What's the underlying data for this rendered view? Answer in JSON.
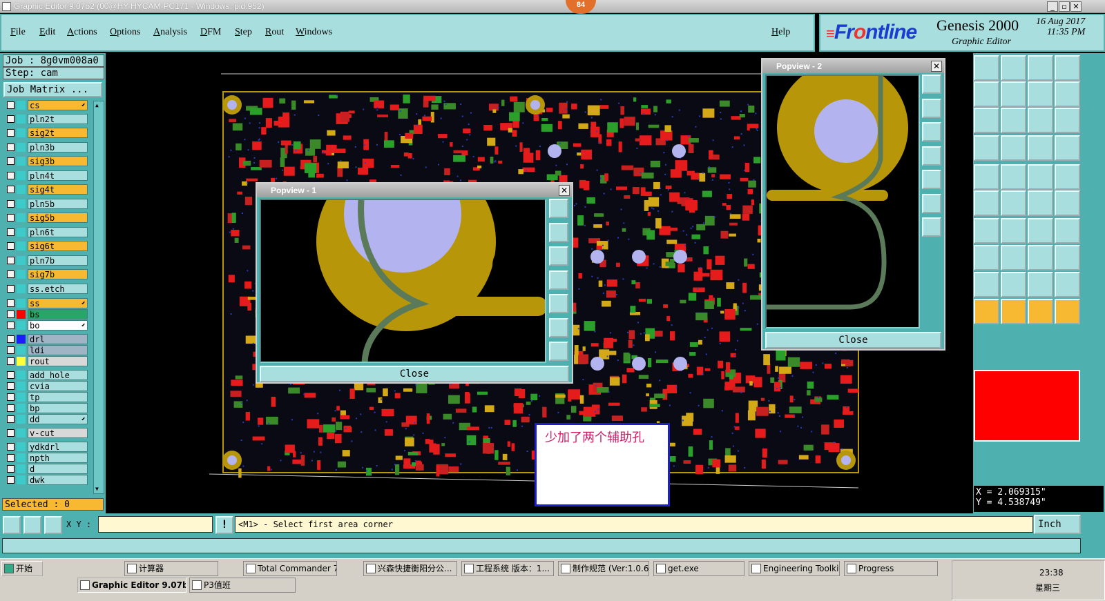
{
  "window": {
    "title": "Graphic Editor 9.07b2 (00@HY-HYCAM-PC171 - Windows, pid:952)",
    "badge": "84"
  },
  "menu": {
    "items": [
      "File",
      "Edit",
      "Actions",
      "Options",
      "Analysis",
      "DFM",
      "Step",
      "Rout",
      "Windows"
    ],
    "help": "Help"
  },
  "branding": {
    "logo_a": "Fr",
    "logo_b": "o",
    "logo_c": "ntline",
    "product": "Genesis 2000",
    "subtitle": "Graphic Editor",
    "date": "16 Aug 2017",
    "time": "11:35 PM"
  },
  "job": {
    "job_label": "Job : 8g0vm008a0",
    "step_label": "Step: cam",
    "matrix_button": "Job Matrix ..."
  },
  "layers": [
    {
      "name": "cs",
      "color": "#f7b832",
      "marker": "#3ecac9",
      "arrow": true
    },
    {
      "name": "pln2t",
      "color": "#a8dede",
      "marker": "#3ecac9"
    },
    {
      "name": "sig2t",
      "color": "#f7b832",
      "marker": "#3ecac9"
    },
    {
      "name": "pln3b",
      "color": "#a8dede",
      "marker": "#3ecac9"
    },
    {
      "name": "sig3b",
      "color": "#f7b832",
      "marker": "#3ecac9"
    },
    {
      "name": "pln4t",
      "color": "#a8dede",
      "marker": "#3ecac9"
    },
    {
      "name": "sig4t",
      "color": "#f7b832",
      "marker": "#3ecac9"
    },
    {
      "name": "pln5b",
      "color": "#a8dede",
      "marker": "#3ecac9"
    },
    {
      "name": "sig5b",
      "color": "#f7b832",
      "marker": "#3ecac9"
    },
    {
      "name": "pln6t",
      "color": "#a8dede",
      "marker": "#3ecac9"
    },
    {
      "name": "sig6t",
      "color": "#f7b832",
      "marker": "#3ecac9"
    },
    {
      "name": "pln7b",
      "color": "#a8dede",
      "marker": "#3ecac9"
    },
    {
      "name": "sig7b",
      "color": "#f7b832",
      "marker": "#3ecac9"
    },
    {
      "name": "ss.etch",
      "color": "#a8dede",
      "marker": "#3ecac9"
    },
    {
      "name": "ss",
      "color": "#f7b832",
      "marker": "#3ecac9",
      "arrow": true
    },
    {
      "name": "bs",
      "color": "#2aa56a",
      "marker": "#ff0000"
    },
    {
      "name": "bo",
      "color": "#ffffff",
      "marker": "#3ecac9",
      "arrow": true
    },
    {
      "name": "drl",
      "color": "#9fb4c4",
      "marker": "#1c1cff"
    },
    {
      "name": "ldi",
      "color": "#9fb4c4",
      "marker": "#3ecac9"
    },
    {
      "name": "rout",
      "color": "#d8d8d8",
      "marker": "#ffff3a"
    },
    {
      "name": "add_hole",
      "color": "#a8dede",
      "marker": "#3ecac9"
    },
    {
      "name": "cvia",
      "color": "#a8dede",
      "marker": "#3ecac9"
    },
    {
      "name": "tp",
      "color": "#a8dede",
      "marker": "#3ecac9"
    },
    {
      "name": "bp",
      "color": "#a8dede",
      "marker": "#3ecac9"
    },
    {
      "name": "dd",
      "color": "#a8dede",
      "marker": "#3ecac9",
      "arrow": true
    },
    {
      "name": "v-cut",
      "color": "#d8d8d8",
      "marker": "#3ecac9"
    },
    {
      "name": "ydkdrl",
      "color": "#a8dede",
      "marker": "#3ecac9"
    },
    {
      "name": "npth",
      "color": "#a8dede",
      "marker": "#3ecac9"
    },
    {
      "name": "d",
      "color": "#a8dede",
      "marker": "#3ecac9"
    },
    {
      "name": "dwk",
      "color": "#a8dede",
      "marker": "#3ecac9"
    }
  ],
  "selected": "Selected : 0",
  "popview1": {
    "title": "Popview - 1",
    "close": "Close"
  },
  "popview2": {
    "title": "Popview - 2",
    "close": "Close"
  },
  "note": "少加了两个辅助孔",
  "coords": {
    "x": "X = 2.069315\"",
    "y": "Y = 4.538749\""
  },
  "command": {
    "xy_label": "X Y :",
    "xy_value": "",
    "prompt": "<M1> - Select first area corner",
    "unit": "Inch"
  },
  "taskbar": {
    "start": "开始",
    "row1": [
      "计算器",
      "Total Commander 7....",
      "兴森快捷衡阳分公...",
      "工程系统  版本：1...",
      "制作规范 (Ver:1.0.6)",
      "get.exe",
      "Engineering Toolkit 9...",
      "Progress"
    ],
    "row2": [
      "Graphic Editor 9.07b2 ...",
      "P3值班"
    ],
    "clock": "23:38",
    "day": "星期三"
  }
}
